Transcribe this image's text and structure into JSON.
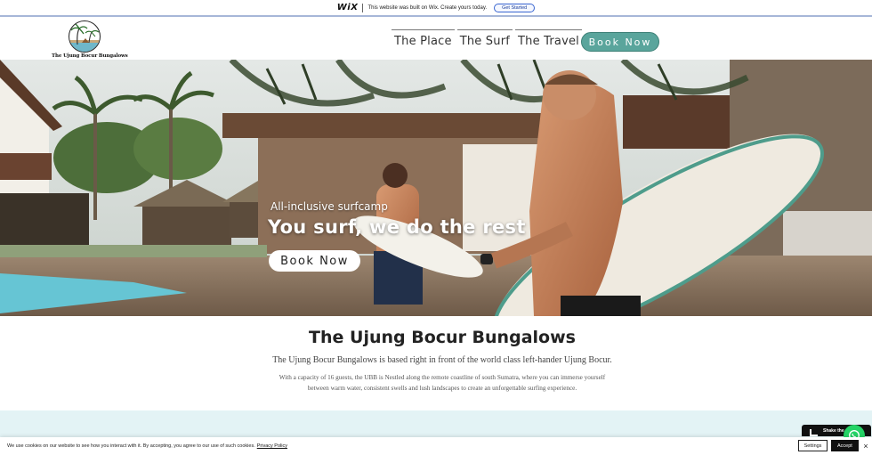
{
  "wix_banner": {
    "logo": "WiX",
    "message": "This website was built on Wix. Create yours today.",
    "cta": "Get Started"
  },
  "header": {
    "logo_text": "The Ujung Bocur Bungalows",
    "nav": [
      {
        "label": "The Place"
      },
      {
        "label": "The Surf"
      },
      {
        "label": "The Travel"
      }
    ],
    "book_label": "Book Now"
  },
  "hero": {
    "subtitle": "All-inclusive surfcamp",
    "title": "You surf, we do the rest",
    "book_label": "Book Now"
  },
  "intro": {
    "title": "The Ujung Bocur Bungalows",
    "lead": "The Ujung Bocur Bungalows is based right in front of the world class left-hander Ujung Bocur.",
    "body": "With a capacity of 16 guests, the UBB is Nestled along the remote coastline of south Sumatra, where you can immerse yourself between warm water, consistent swells and lush landscapes to create an unforgettable surfing experience."
  },
  "chat": {
    "label": "Shake the..."
  },
  "cookie": {
    "text": "We use cookies on our website to see how you interact with it. By accepting, you agree to our use of such cookies.",
    "link": "Privacy Policy",
    "settings": "Settings",
    "accept": "Accept",
    "close": "×"
  },
  "colors": {
    "accent": "#5aa59c",
    "teal_band": "#e3f3f5",
    "whatsapp": "#25d366"
  }
}
